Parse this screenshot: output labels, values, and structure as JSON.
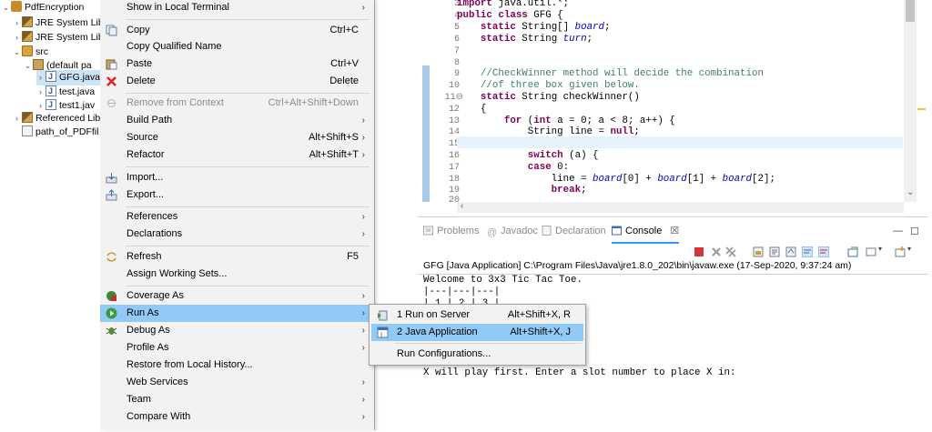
{
  "explorer": {
    "items": [
      {
        "label": "PdfEncryption",
        "twisty": "⌄"
      },
      {
        "label": "JRE System Lib",
        "twisty": "›"
      },
      {
        "label": "JRE System Lib",
        "twisty": "›"
      },
      {
        "label": "src",
        "twisty": "⌄"
      },
      {
        "label": "(default pa",
        "twisty": "⌄"
      },
      {
        "label": "GFG.java",
        "twisty": "›"
      },
      {
        "label": "test.java",
        "twisty": "›"
      },
      {
        "label": "test1.jav",
        "twisty": "›"
      },
      {
        "label": "Referenced Lib",
        "twisty": "›"
      },
      {
        "label": "path_of_PDFfil",
        "twisty": ""
      }
    ]
  },
  "context_menu": {
    "items": [
      {
        "label": "Show in Local Terminal",
        "shortcut": "",
        "arrow": "›"
      },
      {
        "label": "Copy",
        "shortcut": "Ctrl+C"
      },
      {
        "label": "Copy Qualified Name",
        "shortcut": ""
      },
      {
        "label": "Paste",
        "shortcut": "Ctrl+V"
      },
      {
        "label": "Delete",
        "shortcut": "Delete"
      },
      {
        "label": "Remove from Context",
        "shortcut": "Ctrl+Alt+Shift+Down"
      },
      {
        "label": "Build Path",
        "shortcut": "",
        "arrow": "›"
      },
      {
        "label": "Source",
        "shortcut": "Alt+Shift+S",
        "arrow": "›"
      },
      {
        "label": "Refactor",
        "shortcut": "Alt+Shift+T",
        "arrow": "›"
      },
      {
        "label": "Import...",
        "shortcut": ""
      },
      {
        "label": "Export...",
        "shortcut": ""
      },
      {
        "label": "References",
        "shortcut": "",
        "arrow": "›"
      },
      {
        "label": "Declarations",
        "shortcut": "",
        "arrow": "›"
      },
      {
        "label": "Refresh",
        "shortcut": "F5"
      },
      {
        "label": "Assign Working Sets...",
        "shortcut": ""
      },
      {
        "label": "Coverage As",
        "shortcut": "",
        "arrow": "›"
      },
      {
        "label": "Run As",
        "shortcut": "",
        "arrow": "›"
      },
      {
        "label": "Debug As",
        "shortcut": "",
        "arrow": "›"
      },
      {
        "label": "Profile As",
        "shortcut": "",
        "arrow": "›"
      },
      {
        "label": "Restore from Local History...",
        "shortcut": ""
      },
      {
        "label": "Web Services",
        "shortcut": "",
        "arrow": "›"
      },
      {
        "label": "Team",
        "shortcut": "",
        "arrow": "›"
      },
      {
        "label": "Compare With",
        "shortcut": "",
        "arrow": "›"
      }
    ]
  },
  "submenu": {
    "items": [
      {
        "label": "1 Run on Server",
        "shortcut": "Alt+Shift+X, R"
      },
      {
        "label": "2 Java Application",
        "shortcut": "Alt+Shift+X, J"
      },
      {
        "label": "Run Configurations...",
        "shortcut": ""
      }
    ]
  },
  "editor": {
    "line_numbers": [
      "3",
      "4",
      "5",
      "6",
      "7",
      "8",
      "9",
      "10",
      "11⊖",
      "12",
      "13",
      "14",
      "15",
      "16",
      "17",
      "18",
      "19",
      "20"
    ],
    "lines": [
      "import java.util.*;",
      "public class GFG {",
      "    static String[] board;",
      "    static String turn;",
      "",
      "",
      "    //CheckWinner method will decide the combination",
      "    //of three box given below.",
      "    static String checkWinner()",
      "    {",
      "        for (int a = 0; a < 8; a++) {",
      "            String line = null;",
      "",
      "            switch (a) {",
      "            case 0:",
      "                line = board[0] + board[1] + board[2];",
      "                break;",
      "            case 1:"
    ]
  },
  "panel": {
    "tabs": [
      {
        "label": "Problems",
        "icon": "problems-icon"
      },
      {
        "label": "Javadoc",
        "icon": "javadoc-icon"
      },
      {
        "label": "Declaration",
        "icon": "declaration-icon"
      },
      {
        "label": "Console",
        "icon": "console-icon",
        "close": "☒"
      }
    ],
    "console_description": "GFG [Java Application] C:\\Program Files\\Java\\jre1.8.0_202\\bin\\javaw.exe (17-Sep-2020, 9:37:24 am)",
    "console_lines": [
      "Welcome to 3x3 Tic Tac Toe.",
      "|---|---|---|",
      "| 1 | 2 | 3 |"
    ],
    "console_last_line": "X will play first. Enter a slot number to place X in:",
    "minimize": "—",
    "maximize": "☐"
  },
  "colors": {
    "menu_highlight": "#91c9f7",
    "keyword": "#7f0055",
    "field": "#0000c0",
    "comment": "#3f7f5f",
    "active_tab": "#3399ff"
  }
}
